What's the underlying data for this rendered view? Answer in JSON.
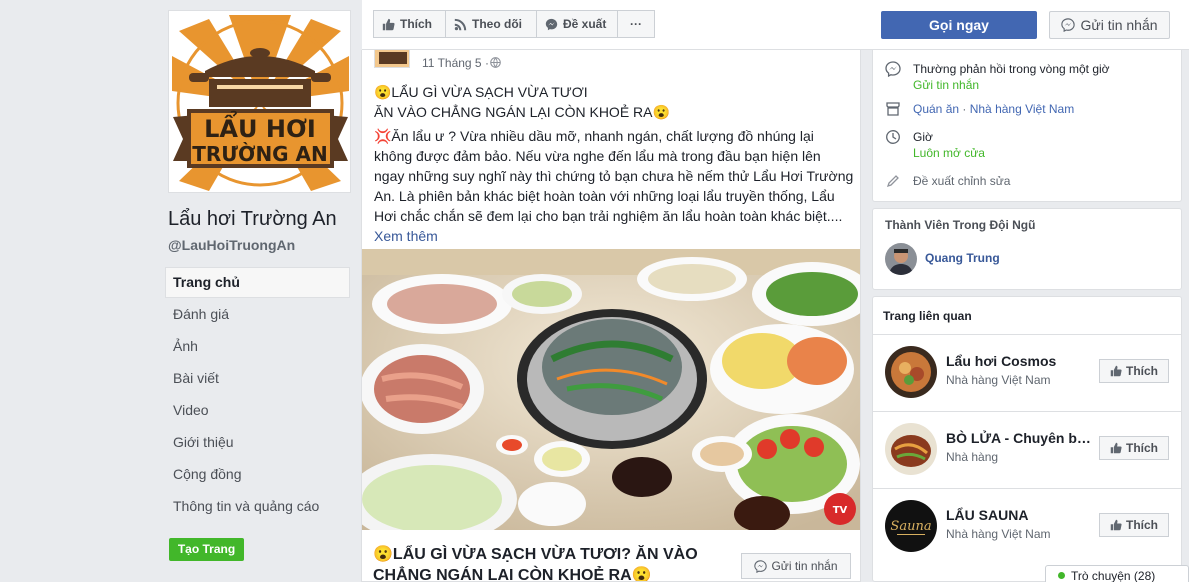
{
  "page": {
    "name": "Lẩu hơi Trường An",
    "handle": "@LauHoiTruongAn",
    "logo_text_line1": "LẨU HƠI",
    "logo_text_line2": "TRƯỜNG AN"
  },
  "nav": {
    "items": [
      "Trang chủ",
      "Đánh giá",
      "Ảnh",
      "Bài viết",
      "Video",
      "Giới thiệu",
      "Cộng đồng",
      "Thông tin và quảng cáo"
    ],
    "active": "Trang chủ",
    "create_page": "Tạo Trang"
  },
  "action_bar": {
    "like": "Thích",
    "follow": "Theo dõi",
    "suggest": "Đề xuất",
    "more": "···",
    "call": "Gọi ngay",
    "send_message": "Gửi tin nhắn"
  },
  "post": {
    "date": "11 Tháng 5 ·",
    "headline_1": "😮LẨU GÌ VỪA SẠCH VỪA TƯƠI",
    "headline_2": "ĂN VÀO CHẲNG NGÁN LẠI CÒN KHOẺ RA😮",
    "body": "💢Ăn lẩu ư ? Vừa nhiều dầu mỡ, nhanh ngán, chất lượng đồ nhúng lại không được đảm bảo. Nếu vừa nghe đến lẩu mà trong đầu bạn hiện lên ngay những suy nghĩ này thì chứng tỏ bạn chưa hề nếm thử Lẩu Hơi Trường An. Là phiên bản khác biệt hoàn toàn với những loại lẩu truyền thống, Lẩu Hơi chắc chắn sẽ đem lại cho bạn trải nghiệm ăn lẩu hoàn toàn khác biệt....",
    "see_more": "Xem thêm",
    "caption": "😮LẨU GÌ VỪA SẠCH VỪA TƯƠI? ĂN VÀO CHẲNG NGÁN LẠI CÒN KHOẺ RA😮",
    "message_button": "Gửi tin nhắn",
    "watermark": "TV"
  },
  "info": {
    "response_time": "Thường phản hồi trong vòng một giờ",
    "send_message": "Gửi tin nhắn",
    "category_1": "Quán ăn",
    "category_sep": " · ",
    "category_2": "Nhà hàng Việt Nam",
    "hours_label": "Giờ",
    "hours_value": "Luôn mở cửa",
    "suggest_edit": "Đề xuất chỉnh sửa"
  },
  "team": {
    "title": "Thành Viên Trong Đội Ngũ",
    "member": "Quang Trung"
  },
  "related": {
    "title": "Trang liên quan",
    "like_label": "Thích",
    "items": [
      {
        "name": "Lẩu hơi Cosmos",
        "category": "Nhà hàng Việt Nam"
      },
      {
        "name": "BÒ LỬA - Chuyên bò …",
        "category": "Nhà hàng"
      },
      {
        "name": "LẨU SAUNA",
        "category": "Nhà hàng Việt Nam"
      }
    ],
    "sauna_logo": "Sauna"
  },
  "chat": {
    "label": "Trò chuyện (28)"
  },
  "colors": {
    "brand_blue": "#4267b2",
    "green": "#42b72a",
    "logo_orange": "#e8952f",
    "logo_brown": "#5a3a22"
  }
}
